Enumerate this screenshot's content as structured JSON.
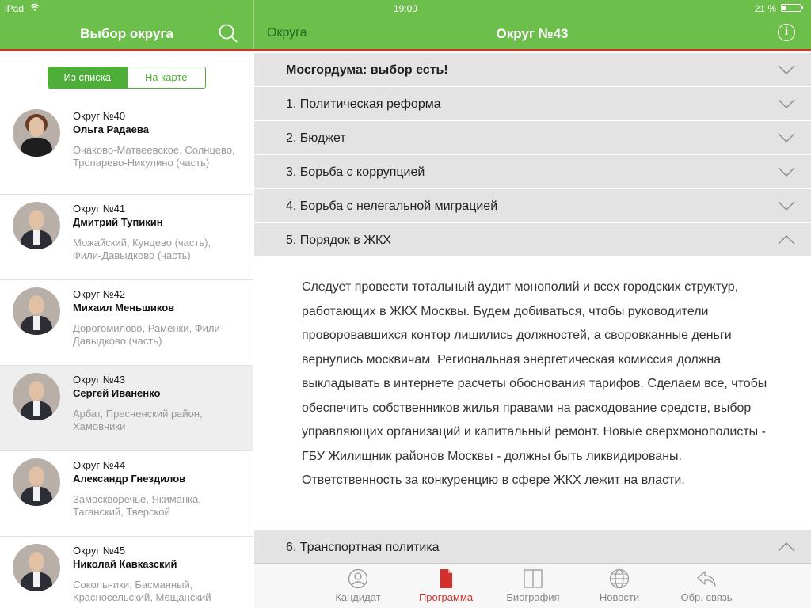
{
  "status_bar": {
    "carrier": "iPad",
    "time": "19:09",
    "battery_percent": "21 %",
    "battery_level": 0.21
  },
  "left_header": {
    "title": "Выбор округа"
  },
  "right_header": {
    "back_label": "Округа",
    "title": "Округ №43"
  },
  "segmented": {
    "list_label": "Из списка",
    "map_label": "На карте",
    "selected": "Из списка"
  },
  "districts": [
    {
      "number": "Округ №40",
      "name": "Ольга Радаева",
      "areas": "Очаково-Матвеевское, Солнцево, Тропарево-Никулино (часть)"
    },
    {
      "number": "Округ №41",
      "name": "Дмитрий Тупикин",
      "areas": "Можайский, Кунцево (часть), Фили-Давыдково (часть)"
    },
    {
      "number": "Округ №42",
      "name": "Михаил Меньшиков",
      "areas": "Дорогомилово, Раменки, Фили-Давыдково (часть)"
    },
    {
      "number": "Округ №43",
      "name": "Сергей Иваненко",
      "areas": "Арбат, Пресненский район, Хамовники"
    },
    {
      "number": "Округ №44",
      "name": "Александр Гнездилов",
      "areas": "Замоскворечье, Якиманка, Таганский, Тверской"
    },
    {
      "number": "Округ №45",
      "name": "Николай Кавказский",
      "areas": "Сокольники, Басманный, Красносельский, Мещанский"
    }
  ],
  "sections": [
    {
      "title": "Мосгордума: выбор есть!",
      "expanded": false
    },
    {
      "title": "1. Политическая реформа",
      "expanded": false
    },
    {
      "title": "2. Бюджет",
      "expanded": false
    },
    {
      "title": "3. Борьба с коррупцией",
      "expanded": false
    },
    {
      "title": "4. Борьба с нелегальной миграцией",
      "expanded": false
    },
    {
      "title": "5. Порядок в ЖКХ",
      "expanded": true
    },
    {
      "title": "6. Транспортная политика",
      "expanded": true
    }
  ],
  "expanded_text": "Следует провести тотальный аудит монополий и всех городских структур, работающих в ЖКХ Москвы. Будем добиваться, чтобы руководители проворовавшихся контор лишились должностей, а своровканные деньги вернулись москвичам. Региональная энергетическая комиссия должна выкладывать в интернете расчеты обоснования тарифов. Сделаем все, чтобы обеспечить собственников жилья правами на расходование средств, выбор управляющих организаций и капитальный ремонт. Новые сверхмонополисты - ГБУ Жилищник районов Москвы - должны быть ликвидированы. Ответственность за конкуренцию в сфере ЖКХ лежит на власти.",
  "tabs": [
    {
      "label": "Кандидат",
      "icon": "person-icon",
      "active": false
    },
    {
      "label": "Программа",
      "icon": "document-icon",
      "active": true
    },
    {
      "label": "Биография",
      "icon": "book-icon",
      "active": false
    },
    {
      "label": "Новости",
      "icon": "globe-icon",
      "active": false
    },
    {
      "label": "Обр. связь",
      "icon": "reply-icon",
      "active": false
    }
  ],
  "colors": {
    "header_green": "#6dbf4b",
    "accent_red": "#c0392b",
    "tab_active": "#d0302b"
  }
}
